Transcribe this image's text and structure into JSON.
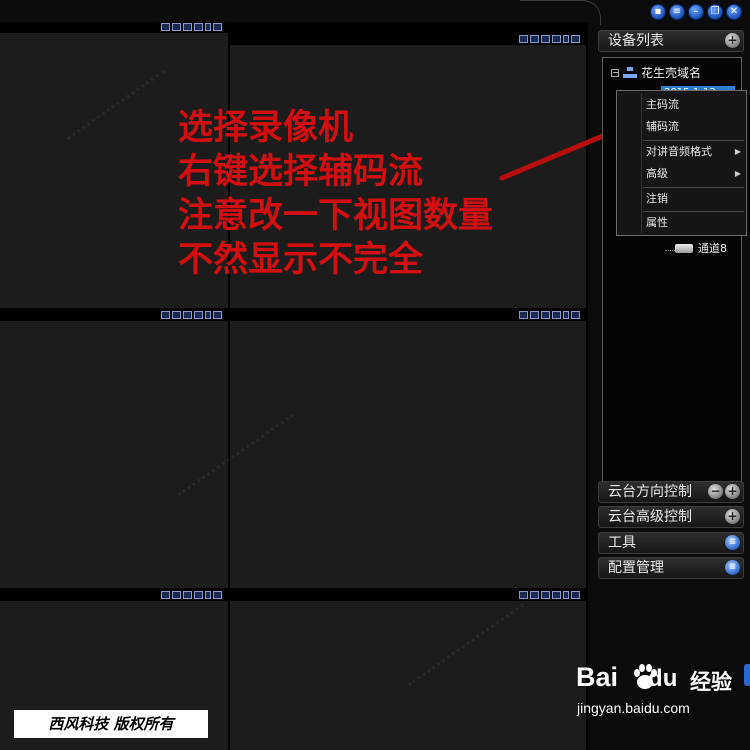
{
  "video_grid": {
    "cell_tool_icons": [
      "view-icon",
      "split-icon",
      "record-icon",
      "snapshot-icon",
      "audio-icon",
      "close-icon"
    ]
  },
  "overlay": {
    "instructions": [
      "选择录像机",
      "右键选择辅码流",
      "注意改一下视图数量",
      "不然显示不完全"
    ],
    "text_color": "#d10f10"
  },
  "window_controls": [
    "lock-icon",
    "list-icon",
    "minimize-icon",
    "restore-icon",
    "close-icon"
  ],
  "device_panel": {
    "title": "设备列表",
    "tree": {
      "root_label": "花生壳域名",
      "device_label": "2015-1-13",
      "channel_label": "通道8"
    }
  },
  "context_menu": {
    "items": [
      {
        "label": "主码流",
        "submenu": false
      },
      {
        "label": "辅码流",
        "submenu": false
      },
      {
        "label": "对讲音频格式",
        "submenu": true
      },
      {
        "label": "高级",
        "submenu": true
      },
      {
        "label": "注销",
        "submenu": false
      },
      {
        "label": "属性",
        "submenu": false
      }
    ]
  },
  "sections": [
    {
      "label": "云台方向控制"
    },
    {
      "label": "云台高级控制"
    },
    {
      "label": "工具"
    },
    {
      "label": "配置管理"
    }
  ],
  "copyright": "西风科技 版权所有",
  "baidu": {
    "logo_left": "Bai",
    "logo_right": "经验",
    "url": "jingyan.baidu.com"
  },
  "colors": {
    "accent_blue": "#2f7fd0",
    "instruction_red": "#d10f10"
  }
}
